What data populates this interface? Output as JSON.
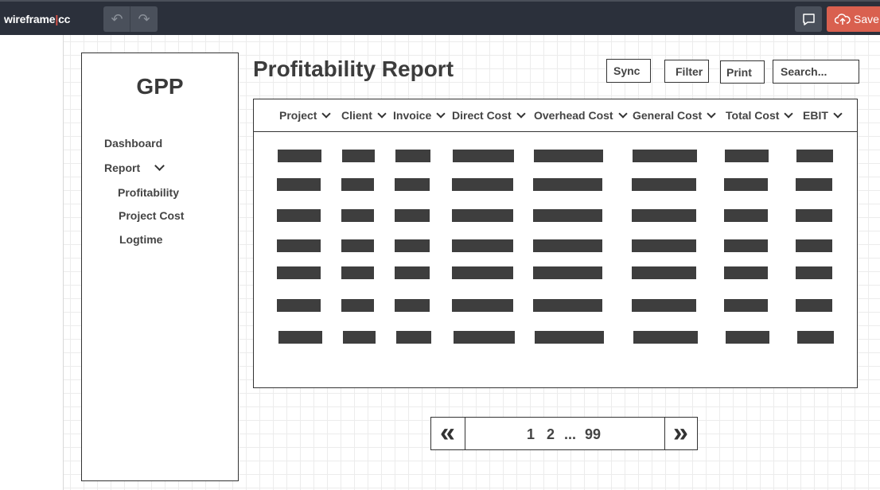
{
  "app": {
    "logo_main": "wireframe",
    "logo_sep": "|",
    "logo_suffix": "cc",
    "undo_glyph": "↶",
    "redo_glyph": "↷",
    "save_label": "Save",
    "accent_color": "#d9604f",
    "toolbar_color": "#2b303b"
  },
  "sidebar": {
    "brand": "GPP",
    "items": [
      {
        "label": "Dashboard"
      },
      {
        "label": "Report"
      },
      {
        "label": "Profitability"
      },
      {
        "label": "Project Cost"
      },
      {
        "label": "Logtime"
      }
    ]
  },
  "header": {
    "title": "Profitability Report",
    "sync_label": "Sync",
    "filter_label": "Filter",
    "print_label": "Print",
    "search_placeholder": "Search..."
  },
  "table": {
    "columns": [
      "Project",
      "Client",
      "Invoice",
      "Direct Cost",
      "Overhead Cost",
      "General Cost",
      "Total Cost",
      "EBIT"
    ],
    "row_count": 7
  },
  "pagination": {
    "prev_glyph": "«",
    "next_glyph": "»",
    "pages": [
      "1",
      "2",
      "...",
      "99"
    ]
  }
}
